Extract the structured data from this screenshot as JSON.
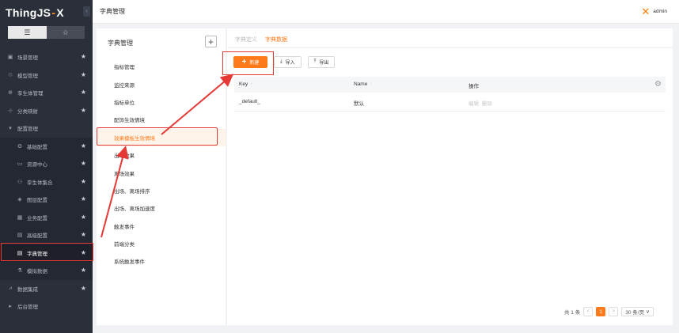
{
  "app": {
    "logo_main": "ThingJS",
    "logo_sep": "-",
    "logo_x": "X",
    "collapse_icon": "‹"
  },
  "view_toggle": {
    "list_icon": "☰",
    "star_icon": "☆"
  },
  "sidebar": {
    "items": [
      {
        "label": "场景管理",
        "icon": "▣",
        "star": "★"
      },
      {
        "label": "模型管理",
        "icon": "♲",
        "star": "★"
      },
      {
        "label": "孪生体管理",
        "icon": "⊕",
        "star": "★"
      },
      {
        "label": "分类映射",
        "icon": "⊹",
        "star": "★"
      },
      {
        "label": "配置管理",
        "icon": "▾",
        "star": ""
      },
      {
        "label": "基础配置",
        "icon": "⚙",
        "star": "★"
      },
      {
        "label": "资源中心",
        "icon": "▭",
        "star": "★"
      },
      {
        "label": "孪生体集合",
        "icon": "⚇",
        "star": "★"
      },
      {
        "label": "图层配置",
        "icon": "◈",
        "star": "★"
      },
      {
        "label": "业务配置",
        "icon": "▦",
        "star": "★"
      },
      {
        "label": "高级配置",
        "icon": "▤",
        "star": "★"
      },
      {
        "label": "字典管理",
        "icon": "▤",
        "star": "★"
      },
      {
        "label": "模拟数据",
        "icon": "⚗",
        "star": "★"
      },
      {
        "label": "数据集成",
        "icon": "⩘",
        "star": "★"
      },
      {
        "label": "后台管理",
        "icon": "▸",
        "star": ""
      }
    ]
  },
  "topbar": {
    "title": "字典管理",
    "user_logo": "✕",
    "user_name": "admin"
  },
  "dict_panel": {
    "title": "字典管理",
    "add_icon": "+",
    "items": [
      "指标管理",
      "监控来源",
      "指标单位",
      "配饰生效情境",
      "效果模板生效情境",
      "出场效果",
      "离场效果",
      "出场、离场排序",
      "出场、离场加速度",
      "触发事件",
      "前端分类",
      "系统触发事件"
    ]
  },
  "main": {
    "tabs": [
      "字典定义",
      "字典数据"
    ],
    "buttons": {
      "new_icon": "+",
      "new_label": "新建",
      "import_icon": "⤓",
      "import_label": "导入",
      "export_icon": "⤒",
      "export_label": "导出"
    },
    "table": {
      "columns": [
        "Key",
        "Name",
        "操作"
      ],
      "sort_icon": "↑",
      "settings_icon": "⚙",
      "rows": [
        {
          "key": "_default_",
          "name": "默认",
          "ops": [
            "编辑",
            "删除"
          ]
        }
      ]
    },
    "pagination": {
      "total": "共 1 条",
      "prev": "<",
      "current": "1",
      "next": ">",
      "page_size": "30 条/页",
      "page_size_caret": "∨"
    }
  },
  "colors": {
    "accent": "#ff7a1a",
    "sidebar_bg": "#2b2f3a",
    "annotation": "#e53935"
  }
}
